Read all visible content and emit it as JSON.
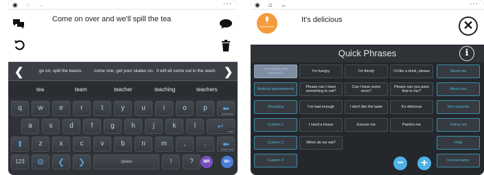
{
  "left_screen": {
    "message": "Come on over and we'll  spill the tea",
    "predictions": [
      "go on, spill the beans.",
      "come one, get your skates on.",
      "it will all come out in the wash."
    ],
    "words": [
      "tea",
      "team",
      "teacher",
      "teaching",
      "teachers"
    ],
    "keyboard": {
      "row1": [
        "q",
        "w",
        "e",
        "r",
        "t",
        "y",
        "u",
        "i",
        "o",
        "p"
      ],
      "row2": [
        "a",
        "s",
        "d",
        "f",
        "g",
        "h",
        "j",
        "k",
        "l"
      ],
      "row3": [
        "z",
        "x",
        "c",
        "v",
        "b",
        "n",
        "m",
        ",",
        "."
      ],
      "row1_end_sub": "backspace",
      "row2_end_sub": "enter",
      "row3_end_sub": "delete word",
      "numbers_label": "123",
      "space_label": "space",
      "exclaim": "!",
      "question": "?",
      "mr_label": "MR",
      "mplus_label": "M+"
    }
  },
  "right_screen": {
    "message": "It's delicious",
    "avatar_label": "Quick Phrases",
    "header_title": "Quick Phrases",
    "info_label": "i",
    "categories": [
      "Greetings and farewells",
      "Medical appointments",
      "Shopping",
      "Custom 1",
      "Custom 2",
      "Custom 3"
    ],
    "phrases": [
      [
        "I'm hungry",
        "I'm thirsty",
        "I'd like a drink, please"
      ],
      [
        "Please can I have something to eat?",
        "Can I have some more?",
        "Please can you pass that to me?"
      ],
      [
        "I've had enough",
        "I don't like the taste",
        "It's delicious"
      ],
      [
        "I need a tissue",
        "Excuse me",
        "Pardon me"
      ],
      [
        "When do we eat?"
      ]
    ],
    "right_column": [
      "About me",
      "About you",
      "Info requests",
      "Going out",
      "Help",
      "Conversation"
    ],
    "minus_label": "−",
    "plus_label": "+"
  },
  "colors": {
    "accent_cyan": "#4fb6d8",
    "key_blue": "#5b9bd8",
    "mr_purple": "#7a4fc0",
    "mplus_blue": "#4a7fd8",
    "avatar_orange": "#f39a3a"
  }
}
